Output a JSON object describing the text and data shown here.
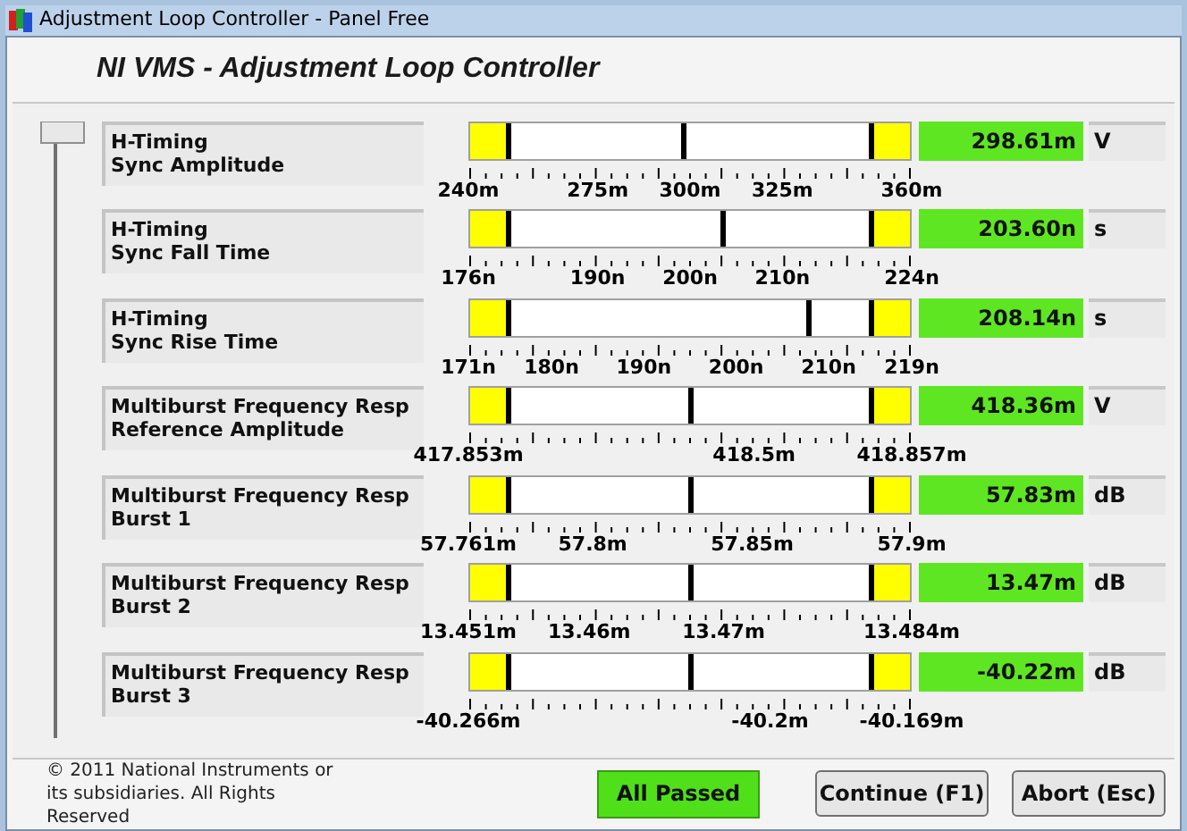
{
  "window": {
    "title": "Adjustment Loop Controller - Panel Free"
  },
  "heading": "NI VMS - Adjustment Loop Controller",
  "measurements": [
    {
      "label_lines": [
        "H-Timing",
        "Sync Amplitude"
      ],
      "level": 0.485,
      "passed": true,
      "reading": "298.61m",
      "unit": "V",
      "scale_labels": [
        "240m",
        "275m",
        "300m",
        "325m",
        "360m"
      ]
    },
    {
      "label_lines": [
        "H-Timing",
        "Sync Fall Time"
      ],
      "level": 0.574,
      "passed": true,
      "reading": "203.60n",
      "unit": "s",
      "scale_labels": [
        "176n",
        "190n",
        "200n",
        "210n",
        "224n"
      ]
    },
    {
      "label_lines": [
        "H-Timing",
        "Sync Rise Time"
      ],
      "level": 0.77,
      "passed": true,
      "reading": "208.14n",
      "unit": "s",
      "scale_labels": [
        "171n",
        "180n",
        "190n",
        "200n",
        "210n",
        "219n"
      ]
    },
    {
      "label_lines": [
        "Multiburst Frequency Resp",
        "Reference Amplitude"
      ],
      "level": 0.5,
      "passed": true,
      "reading": "418.36m",
      "unit": "V",
      "scale_labels": [
        "417.853m",
        "418.5m",
        "418.857m"
      ]
    },
    {
      "label_lines": [
        "Multiburst Frequency Resp",
        "Burst 1"
      ],
      "level": 0.5,
      "passed": true,
      "reading": "57.83m",
      "unit": "dB",
      "scale_labels": [
        "57.761m",
        "57.8m",
        "57.85m",
        "57.9m"
      ]
    },
    {
      "label_lines": [
        "Multiburst Frequency Resp",
        "Burst 2"
      ],
      "level": 0.5,
      "passed": true,
      "reading": "13.47m",
      "unit": "dB",
      "scale_labels": [
        "13.451m",
        "13.46m",
        "13.47m",
        "13.484m"
      ]
    },
    {
      "label_lines": [
        "Multiburst Frequency Resp",
        "Burst 3"
      ],
      "level": 0.5,
      "passed": true,
      "reading": "-40.22m",
      "unit": "dB",
      "scale_labels": [
        "-40.266m",
        "-40.2m",
        "-40.169m"
      ]
    }
  ],
  "copyright": "© 2011 National Instruments or its subsidiaries. All Rights Reserved",
  "status": {
    "text": "All Passed",
    "passed": true
  },
  "buttons": [
    "Continue (F1)",
    "Abort (Esc)"
  ]
}
